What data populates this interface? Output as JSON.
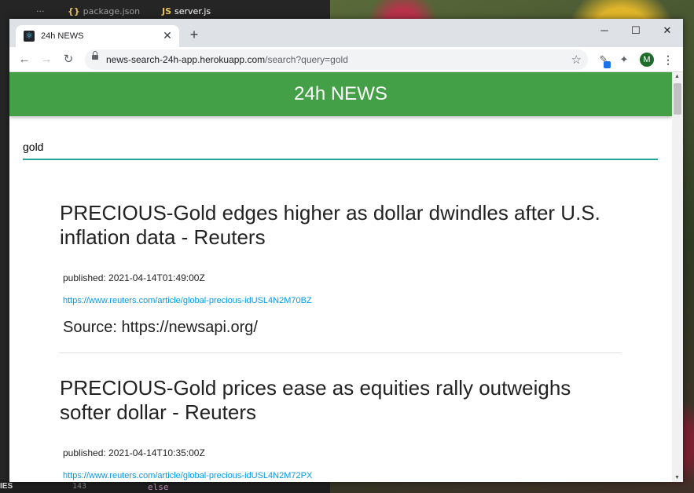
{
  "editor": {
    "tabs": [
      "package.json",
      "server.js"
    ],
    "bottom_line_number": "143",
    "bottom_code": "else",
    "bottom_panel_label": "IES"
  },
  "browser": {
    "tab": {
      "title": "24h NEWS"
    },
    "window_controls": {
      "minimize": "─",
      "maximize": "☐",
      "close": "✕"
    },
    "address": {
      "host": "news-search-24h-app.herokuapp.com",
      "path": "/search?query=gold"
    },
    "profile_initial": "M"
  },
  "page": {
    "header_title": "24h NEWS",
    "search_value": "gold",
    "articles": [
      {
        "title": "PRECIOUS-Gold edges higher as dollar dwindles after U.S. inflation data - Reuters",
        "published": "published: 2021-04-14T01:49:00Z",
        "url": "https://www.reuters.com/article/global-precious-idUSL4N2M70BZ",
        "source": "Source: https://newsapi.org/"
      },
      {
        "title": "PRECIOUS-Gold prices ease as equities rally outweighs softer dollar - Reuters",
        "published": "published: 2021-04-14T10:35:00Z",
        "url": "https://www.reuters.com/article/global-precious-idUSL4N2M72PX"
      }
    ]
  },
  "colors": {
    "header_green": "#43a047",
    "search_underline": "#26a69a",
    "link_blue": "#039be5"
  }
}
